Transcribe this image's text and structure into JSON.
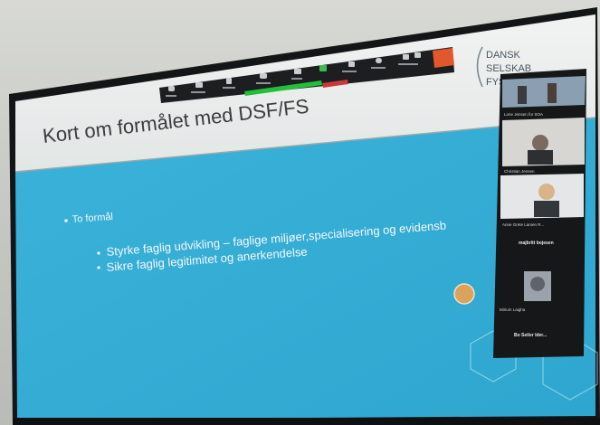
{
  "slide": {
    "title": "Kort om formålet med DSF/FS",
    "logo_lines": [
      "DANSK",
      "SELSKAB",
      "FYS"
    ],
    "bullet": "To formål",
    "subbullets": [
      "Styrke faglig udvikling – faglige miljøer,specialisering og evidensb",
      "Sikre faglig legitimitet og anerkendelse"
    ]
  },
  "participants": [
    {
      "name": "Lone Jensen for SOA"
    },
    {
      "name": "Christian Jensen"
    },
    {
      "name": "Anne Grete Larsen R..."
    },
    {
      "name": "majbritt bojesen"
    },
    {
      "name": "Mirium Laigha"
    },
    {
      "name": "Bo Seiler Ider..."
    }
  ],
  "colors": {
    "slide_blue": "#3fb1d6",
    "toolbar": "#1e1f21",
    "end_button": "#e2572c",
    "active_green": "#22c03a"
  },
  "toolbar": {
    "icons": [
      "mute-icon",
      "video-icon",
      "security-icon",
      "participants-icon",
      "chat-icon",
      "share-icon",
      "record-icon",
      "reactions-icon",
      "annotate-icon",
      "more-icon",
      "end-icon"
    ]
  }
}
